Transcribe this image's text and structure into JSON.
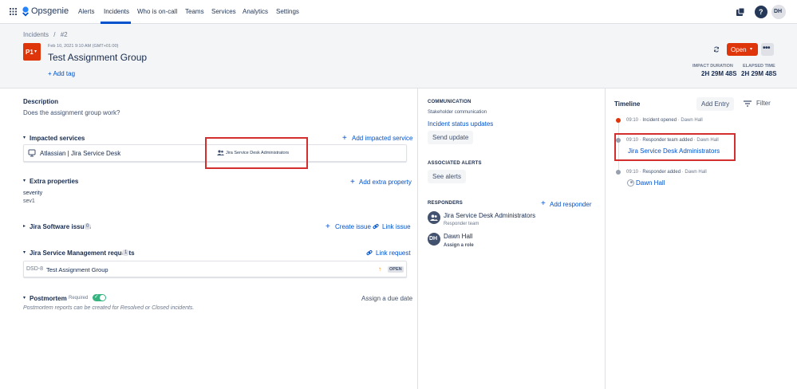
{
  "nav": {
    "logo": "Opsgenie",
    "items": [
      "Alerts",
      "Incidents",
      "Who is on-call",
      "Teams",
      "Services",
      "Analytics",
      "Settings"
    ],
    "avatar": "DH"
  },
  "breadcrumb": {
    "root": "Incidents",
    "sep": "/",
    "id": "#2"
  },
  "incident": {
    "priority": "P1",
    "date": "Feb 10, 2021 9:10 AM (GMT+01:00)",
    "title": "Test Assignment Group",
    "add_tag": "+ Add tag",
    "status": "Open",
    "impact_label": "IMPACT DURATION",
    "impact_value": "2H 29M 48S",
    "elapsed_label": "ELAPSED TIME",
    "elapsed_value": "2H 29M 48S"
  },
  "description": {
    "label": "Description",
    "text": "Does the assignment group work?"
  },
  "impacted": {
    "label": "Impacted services",
    "add": "Add impacted service",
    "service": "Atlassian | Jira Service Desk",
    "team": "Jira Service Desk Administrators"
  },
  "extra": {
    "label": "Extra properties",
    "add": "Add extra property",
    "key": "severity",
    "value": "sev1"
  },
  "jira_sw": {
    "label": "Jira Software issues",
    "count": "0",
    "create": "Create issue",
    "link": "Link issue"
  },
  "jsm": {
    "label": "Jira Service Management requests",
    "count": "1",
    "link": "Link request",
    "key": "DSD-8",
    "summary": "Test Assignment Group",
    "status": "OPEN"
  },
  "postmortem": {
    "label": "Postmortem",
    "required": "Required",
    "due": "Assign a due date",
    "note": "Postmortem reports can be created for Resolved or Closed incidents."
  },
  "communication": {
    "label": "COMMUNICATION",
    "sub": "Stakeholder communication",
    "link": "Incident status updates",
    "button": "Send update"
  },
  "alerts": {
    "label": "ASSOCIATED ALERTS",
    "button": "See alerts"
  },
  "responders": {
    "label": "RESPONDERS",
    "add": "Add responder",
    "items": [
      {
        "name": "Jira Service Desk Administrators",
        "role": "Responder team"
      },
      {
        "name": "Dawn Hall",
        "role": "Assign a role",
        "initials": "DH"
      }
    ]
  },
  "timeline": {
    "label": "Timeline",
    "add": "Add Entry",
    "filter": "Filter",
    "entries": [
      {
        "time": "09:10",
        "event": "Incident opened",
        "by": "Dawn Hall",
        "detail": ""
      },
      {
        "time": "09:10",
        "event": "Responder team added",
        "by": "Dawn Hall",
        "detail": "Jira Service Desk Administrators"
      },
      {
        "time": "09:10",
        "event": "Responder added",
        "by": "Dawn Hall",
        "detail": "Dawn Hall"
      }
    ]
  },
  "colors": {
    "accent": "#0052cc",
    "danger": "#de350b",
    "success": "#36b37e",
    "highlight": "#d32f2f"
  }
}
